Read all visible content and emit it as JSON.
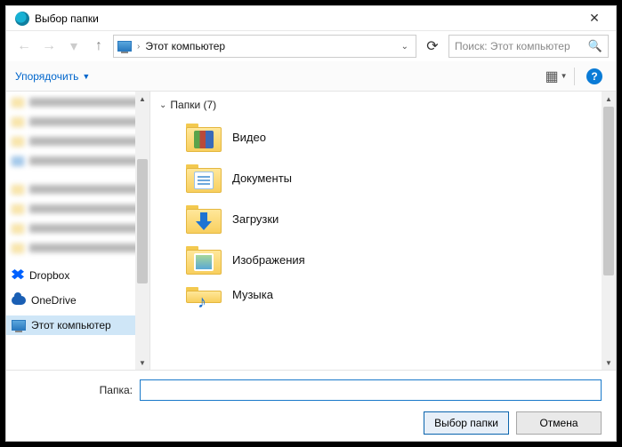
{
  "window": {
    "title": "Выбор папки"
  },
  "nav": {
    "location": "Этот компьютер"
  },
  "search": {
    "placeholder": "Поиск: Этот компьютер"
  },
  "toolbar": {
    "organize": "Упорядочить"
  },
  "sidebar": {
    "dropbox": "Dropbox",
    "onedrive": "OneDrive",
    "this_pc": "Этот компьютер"
  },
  "main": {
    "group_label": "Папки (7)",
    "folders": {
      "video": "Видео",
      "documents": "Документы",
      "downloads": "Загрузки",
      "pictures": "Изображения",
      "music": "Музыка"
    }
  },
  "footer": {
    "folder_label": "Папка:",
    "folder_value": "",
    "select_btn": "Выбор папки",
    "cancel_btn": "Отмена"
  }
}
